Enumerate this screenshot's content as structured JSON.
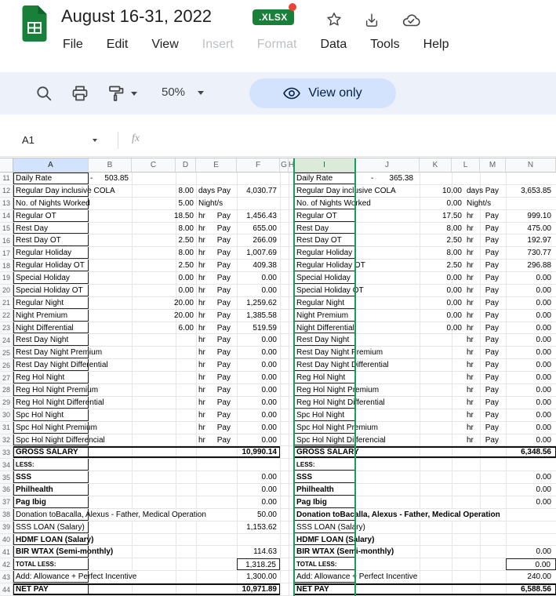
{
  "header": {
    "title": "August 16-31, 2022",
    "file_type_badge": ".XLSX",
    "menus": [
      {
        "label": "File",
        "enabled": true
      },
      {
        "label": "Edit",
        "enabled": true
      },
      {
        "label": "View",
        "enabled": true
      },
      {
        "label": "Insert",
        "enabled": false
      },
      {
        "label": "Format",
        "enabled": false
      },
      {
        "label": "Data",
        "enabled": true
      },
      {
        "label": "Tools",
        "enabled": true
      },
      {
        "label": "Help",
        "enabled": true
      }
    ]
  },
  "toolbar": {
    "zoom": "50%",
    "mode_label": "View only"
  },
  "formula_bar": {
    "name_box": "A1",
    "fx_label": "fx"
  },
  "colors": {
    "badge_green": "#188038",
    "notification_red": "#ea4335",
    "pill_blue": "#d3e3fd",
    "collab_green": "#17a05d",
    "selected_column_blue": "#d3e3fd"
  },
  "icons": {
    "search": "magnifier",
    "print": "printer",
    "paint_format": "paint-roller",
    "view_mode": "eye",
    "star": "star-outline",
    "add_shortcut": "drive-add",
    "saved": "cloud-check",
    "caret": "down-triangle"
  },
  "grid": {
    "columns": [
      "A",
      "B",
      "C",
      "D",
      "E",
      "F",
      "G",
      "H",
      "I",
      "J",
      "K",
      "L",
      "M",
      "N"
    ],
    "selection": {
      "active_cell": "A1",
      "highlighted_column": "A",
      "collaborator_column": "I"
    }
  },
  "sheet": {
    "rows": [
      {
        "row": 11,
        "kind": "rate",
        "label": "Daily Rate",
        "dash": "-",
        "left": {
          "rate": "503.85"
        },
        "right": {
          "rate": "365.38"
        }
      },
      {
        "row": 12,
        "label": "Regular Day inclusive COLA",
        "left": {
          "hours": "8.00",
          "unit": "days",
          "pay": "Pay",
          "amount": "4,030.77"
        },
        "right": {
          "hours": "10.00",
          "unit": "days",
          "pay": "Pay",
          "amount": "3,653.85"
        }
      },
      {
        "row": 13,
        "label": "No. of Nights Worked",
        "left": {
          "hours": "5.00",
          "unit": "Night/s"
        },
        "right": {
          "hours": "0.00",
          "unit": "Night/s"
        }
      },
      {
        "row": 14,
        "label": "Regular OT",
        "left": {
          "hours": "18.50",
          "unit": "hr",
          "pay": "Pay",
          "amount": "1,456.43"
        },
        "right": {
          "hours": "17.50",
          "unit": "hr",
          "pay": "Pay",
          "amount": "999.10"
        }
      },
      {
        "row": 15,
        "label": "Rest Day",
        "left": {
          "hours": "8.00",
          "unit": "hr",
          "pay": "Pay",
          "amount": "655.00"
        },
        "right": {
          "hours": "8.00",
          "unit": "hr",
          "pay": "Pay",
          "amount": "475.00"
        }
      },
      {
        "row": 16,
        "label": "Rest Day OT",
        "left": {
          "hours": "2.50",
          "unit": "hr",
          "pay": "Pay",
          "amount": "266.09"
        },
        "right": {
          "hours": "2.50",
          "unit": "hr",
          "pay": "Pay",
          "amount": "192.97"
        }
      },
      {
        "row": 17,
        "label": "Regular Holiday",
        "left": {
          "hours": "8.00",
          "unit": "hr",
          "pay": "Pay",
          "amount": "1,007.69"
        },
        "right": {
          "hours": "8.00",
          "unit": "hr",
          "pay": "Pay",
          "amount": "730.77"
        }
      },
      {
        "row": 18,
        "label": "Regular Holiday OT",
        "left": {
          "hours": "2.50",
          "unit": "hr",
          "pay": "Pay",
          "amount": "409.38"
        },
        "right": {
          "hours": "2.50",
          "unit": "hr",
          "pay": "Pay",
          "amount": "296.88"
        }
      },
      {
        "row": 19,
        "label": "Special Holiday",
        "left": {
          "hours": "0.00",
          "unit": "hr",
          "pay": "Pay",
          "amount": "0.00"
        },
        "right": {
          "hours": "0.00",
          "unit": "hr",
          "pay": "Pay",
          "amount": "0.00"
        }
      },
      {
        "row": 20,
        "label": "Special Holiday OT",
        "left": {
          "hours": "0.00",
          "unit": "hr",
          "pay": "Pay",
          "amount": "0.00"
        },
        "right": {
          "hours": "0.00",
          "unit": "hr",
          "pay": "Pay",
          "amount": "0.00"
        }
      },
      {
        "row": 21,
        "label": "Regular Night",
        "left": {
          "hours": "20.00",
          "unit": "hr",
          "pay": "Pay",
          "amount": "1,259.62"
        },
        "right": {
          "hours": "0.00",
          "unit": "hr",
          "pay": "Pay",
          "amount": "0.00"
        }
      },
      {
        "row": 22,
        "label": "Night Premium",
        "left": {
          "hours": "20.00",
          "unit": "hr",
          "pay": "Pay",
          "amount": "1,385.58"
        },
        "right": {
          "hours": "0.00",
          "unit": "hr",
          "pay": "Pay",
          "amount": "0.00"
        }
      },
      {
        "row": 23,
        "label": "Night Differential",
        "left": {
          "hours": "6.00",
          "unit": "hr",
          "pay": "Pay",
          "amount": "519.59"
        },
        "right": {
          "hours": "0.00",
          "unit": "hr",
          "pay": "Pay",
          "amount": "0.00"
        }
      },
      {
        "row": 24,
        "label": "Rest Day Night",
        "left": {
          "unit": "hr",
          "pay": "Pay",
          "amount": "0.00"
        },
        "right": {
          "unit": "hr",
          "pay": "Pay",
          "amount": "0.00"
        }
      },
      {
        "row": 25,
        "label": "Rest Day Night Premium",
        "left": {
          "unit": "hr",
          "pay": "Pay",
          "amount": "0.00"
        },
        "right": {
          "unit": "hr",
          "pay": "Pay",
          "amount": "0.00"
        }
      },
      {
        "row": 26,
        "label": "Rest Day Night Differential",
        "left": {
          "unit": "hr",
          "pay": "Pay",
          "amount": "0.00"
        },
        "right": {
          "unit": "hr",
          "pay": "Pay",
          "amount": "0.00"
        }
      },
      {
        "row": 27,
        "label": "Reg Hol Night",
        "left": {
          "unit": "hr",
          "pay": "Pay",
          "amount": "0.00"
        },
        "right": {
          "unit": "hr",
          "pay": "Pay",
          "amount": "0.00"
        }
      },
      {
        "row": 28,
        "label": "Reg Hol Night Premium",
        "left": {
          "unit": "hr",
          "pay": "Pay",
          "amount": "0.00"
        },
        "right": {
          "unit": "hr",
          "pay": "Pay",
          "amount": "0.00"
        }
      },
      {
        "row": 29,
        "label": "Reg Hol Night Differential",
        "left": {
          "unit": "hr",
          "pay": "Pay",
          "amount": "0.00"
        },
        "right": {
          "unit": "hr",
          "pay": "Pay",
          "amount": "0.00"
        }
      },
      {
        "row": 30,
        "label": "Spc Hol Night",
        "left": {
          "unit": "hr",
          "pay": "Pay",
          "amount": "0.00"
        },
        "right": {
          "unit": "hr",
          "pay": "Pay",
          "amount": "0.00"
        }
      },
      {
        "row": 31,
        "label": "Spc Hol Night Premium",
        "left": {
          "unit": "hr",
          "pay": "Pay",
          "amount": "0.00"
        },
        "right": {
          "unit": "hr",
          "pay": "Pay",
          "amount": "0.00"
        }
      },
      {
        "row": 32,
        "label": "Spc Hol Night Differencial",
        "left": {
          "unit": "hr",
          "pay": "Pay",
          "amount": "0.00"
        },
        "right": {
          "unit": "hr",
          "pay": "Pay",
          "amount": "0.00"
        }
      },
      {
        "row": 33,
        "kind": "total",
        "label": "GROSS SALARY",
        "left": {
          "amount": "10,990.14"
        },
        "right": {
          "amount": "6,348.56"
        }
      },
      {
        "row": 34,
        "label": "LESS:",
        "bold": true,
        "small": true,
        "left": {},
        "right": {}
      },
      {
        "row": 35,
        "label": "SSS",
        "bold": true,
        "left": {
          "amount": "0.00"
        },
        "right": {
          "amount": "0.00"
        }
      },
      {
        "row": 36,
        "label": "Philhealth",
        "bold": true,
        "left": {
          "amount": "0.00"
        },
        "right": {
          "amount": "0.00"
        }
      },
      {
        "row": 37,
        "label": "Pag Ibig",
        "bold": true,
        "left": {
          "amount": "0.00"
        },
        "right": {
          "amount": "0.00"
        }
      },
      {
        "row": 38,
        "label": "Donation toBacalla, Alexus - Father, Medical Operation",
        "right_bold": true,
        "left": {
          "amount": "50.00"
        },
        "right": {}
      },
      {
        "row": 39,
        "label": "SSS LOAN (Salary)",
        "left": {
          "amount": "1,153.62"
        },
        "right": {}
      },
      {
        "row": 40,
        "label": "HDMF LOAN (Salary)",
        "bold": true,
        "left": {},
        "right": {}
      },
      {
        "row": 41,
        "label": "BIR WTAX (Semi-monthly)",
        "bold": true,
        "left": {
          "amount": "114.63"
        },
        "right": {
          "amount": "0.00"
        }
      },
      {
        "row": 42,
        "kind": "subtotal",
        "label": "TOTAL LESS:",
        "bold": true,
        "small": true,
        "left": {
          "amount": "1,318.25"
        },
        "right": {
          "amount": "0.00"
        }
      },
      {
        "row": 43,
        "label": "Add: Allowance + Perfect Incentive",
        "left": {
          "amount": "1,300.00"
        },
        "right": {
          "amount": "240.00"
        }
      },
      {
        "row": 44,
        "kind": "total",
        "label": "NET PAY",
        "left": {
          "amount": "10,971.89"
        },
        "right": {
          "amount": "6,588.56"
        }
      }
    ]
  }
}
